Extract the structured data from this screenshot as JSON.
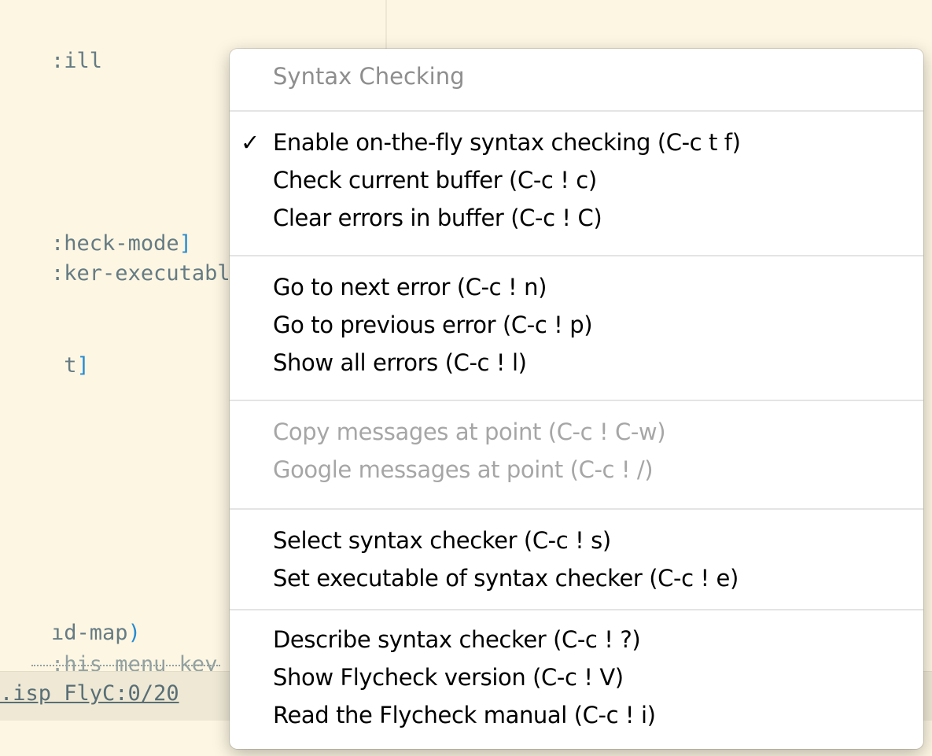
{
  "editor": {
    "lines": [
      {
        "text": ":ill"
      },
      {
        "text": ":heck-mode",
        "bracket": "]"
      },
      {
        "text": ":ker-executabl"
      },
      {
        "text": " t",
        "bracket": "]"
      },
      {
        "text": "ıd-map",
        "bracket": ")"
      },
      {
        "text": ":his menu key"
      }
    ],
    "modeline": ".isp FlyC:0/20"
  },
  "menu": {
    "title": "Syntax Checking",
    "groups": [
      [
        {
          "label": "Enable on-the-fly syntax checking (C-c t f)",
          "checked": true,
          "enabled": true
        },
        {
          "label": "Check current buffer (C-c ! c)",
          "enabled": true
        },
        {
          "label": "Clear errors in buffer (C-c ! C)",
          "enabled": true
        }
      ],
      [
        {
          "label": "Go to next error (C-c ! n)",
          "enabled": true
        },
        {
          "label": "Go to previous error (C-c ! p)",
          "enabled": true
        },
        {
          "label": "Show all errors (C-c ! l)",
          "enabled": true
        }
      ],
      [
        {
          "label": "Copy messages at point (C-c ! C-w)",
          "enabled": false
        },
        {
          "label": "Google messages at point (C-c ! /)",
          "enabled": false
        }
      ],
      [
        {
          "label": "Select syntax checker (C-c ! s)",
          "enabled": true
        },
        {
          "label": "Set executable of syntax checker (C-c ! e)",
          "enabled": true
        }
      ],
      [
        {
          "label": "Describe syntax checker (C-c ! ?)",
          "enabled": true
        },
        {
          "label": "Show Flycheck version (C-c ! V)",
          "enabled": true
        },
        {
          "label": "Read the Flycheck manual (C-c ! i)",
          "enabled": true
        }
      ]
    ],
    "check_glyph": "✓"
  }
}
